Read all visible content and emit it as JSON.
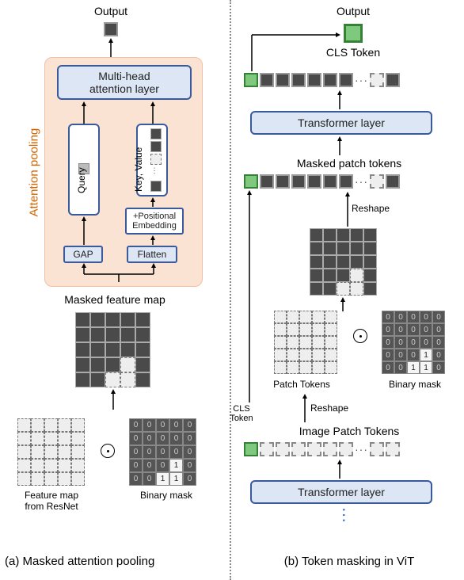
{
  "left": {
    "output": "Output",
    "mha": "Multi-head\nattention layer",
    "query": "Query",
    "kv": "Key, Value",
    "pos_embed": "+Positional\nEmbedding",
    "gap": "GAP",
    "flatten": "Flatten",
    "pooling": "Attention pooling",
    "masked_feature_map": "Masked feature map",
    "feature_map": "Feature map\nfrom ResNet",
    "binary_mask": "Binary mask",
    "caption": "(a)  Masked attention pooling"
  },
  "right": {
    "output": "Output",
    "cls_token": "CLS Token",
    "transformer_top": "Transformer layer",
    "masked_patch_tokens": "Masked patch tokens",
    "reshape_upper": "Reshape",
    "patch_tokens": "Patch Tokens",
    "binary_mask": "Binary mask",
    "cls_label": "CLS\nToken",
    "reshape_lower": "Reshape",
    "image_patch_tokens": "Image Patch Tokens",
    "transformer_bottom": "Transformer layer",
    "caption": "(b) Token masking in ViT"
  },
  "mask_values": [
    [
      "0",
      "0",
      "0",
      "0",
      "0"
    ],
    [
      "0",
      "0",
      "0",
      "0",
      "0"
    ],
    [
      "0",
      "0",
      "0",
      "0",
      "0"
    ],
    [
      "0",
      "0",
      "0",
      "1",
      "0"
    ],
    [
      "0",
      "0",
      "1",
      "1",
      "0"
    ]
  ],
  "chart_data": {
    "type": "diagram",
    "title": "Masked attention pooling and Token masking in ViT",
    "panels": [
      {
        "id": "a",
        "label": "Masked attention pooling",
        "flow": [
          "Feature map from ResNet ⊙ Binary mask",
          "Masked feature map",
          "Attention pooling: GAP → Query; Flatten → +Positional Embedding → Key, Value",
          "Multi-head attention layer",
          "Output"
        ]
      },
      {
        "id": "b",
        "label": "Token masking in ViT",
        "flow": [
          "Transformer layer",
          "Image Patch Tokens (with CLS Token)",
          "Reshape → Patch Tokens ⊙ Binary mask",
          "Reshape → Masked patch tokens",
          "Transformer layer",
          "CLS Token → Output"
        ]
      }
    ],
    "binary_mask_grid_size": [
      5,
      5
    ],
    "binary_mask_ones_positions": [
      [
        3,
        3
      ],
      [
        4,
        2
      ],
      [
        4,
        3
      ]
    ]
  }
}
